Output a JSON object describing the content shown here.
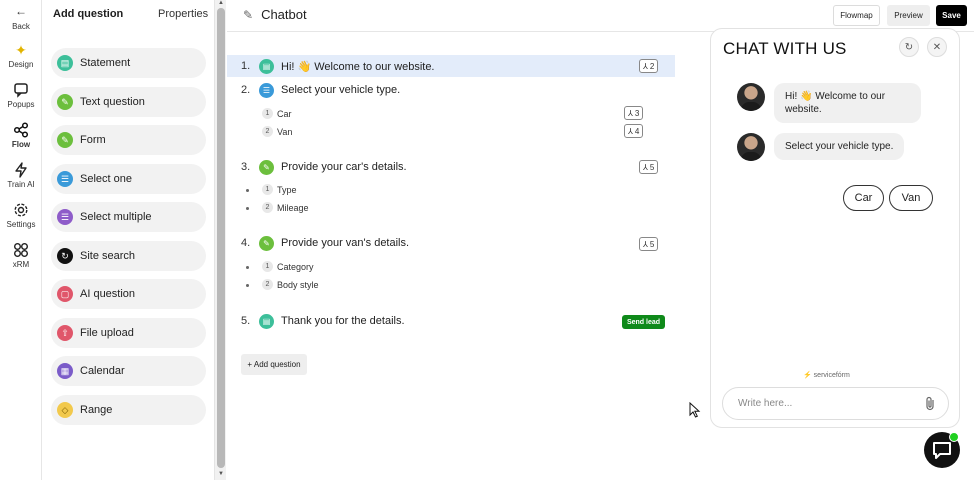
{
  "rail": {
    "back": "Back",
    "items": [
      {
        "label": "Design",
        "icon": "sparkle-icon"
      },
      {
        "label": "Popups",
        "icon": "popup-icon"
      },
      {
        "label": "Flow",
        "icon": "flow-icon"
      },
      {
        "label": "Train AI",
        "icon": "lightning-icon"
      },
      {
        "label": "Settings",
        "icon": "gear-icon"
      },
      {
        "label": "xRM",
        "icon": "grid-icon"
      }
    ]
  },
  "panel": {
    "tab_add": "Add question",
    "tab_properties": "Properties",
    "types": [
      {
        "label": "Statement",
        "color": "#3dbf9a"
      },
      {
        "label": "Text question",
        "color": "#6cbf3d"
      },
      {
        "label": "Form",
        "color": "#6cbf3d"
      },
      {
        "label": "Select one",
        "color": "#3a9ad9"
      },
      {
        "label": "Select multiple",
        "color": "#8e5cc9"
      },
      {
        "label": "Site search",
        "color": "#111111"
      },
      {
        "label": "AI question",
        "color": "#e0566a"
      },
      {
        "label": "File upload",
        "color": "#e0566a"
      },
      {
        "label": "Calendar",
        "color": "#7b5cc9"
      },
      {
        "label": "Range",
        "color": "#f2c94c"
      }
    ]
  },
  "topbar": {
    "title": "Chatbot",
    "flowmap": "Flowmap",
    "preview": "Preview",
    "save": "Save"
  },
  "flow": {
    "questions": [
      {
        "num": "1.",
        "text": "Hi! 👋 Welcome to our website.",
        "jump": "2",
        "color": "#3dbf9a"
      },
      {
        "num": "2.",
        "text": "Select your vehicle type.",
        "color": "#3a9ad9",
        "options": [
          {
            "n": "1",
            "label": "Car",
            "jump": "3"
          },
          {
            "n": "2",
            "label": "Van",
            "jump": "4"
          }
        ]
      },
      {
        "num": "3.",
        "text": "Provide your car's details.",
        "jump": "5",
        "color": "#6cbf3d",
        "options": [
          {
            "n": "1",
            "label": "Type"
          },
          {
            "n": "2",
            "label": "Mileage"
          }
        ]
      },
      {
        "num": "4.",
        "text": "Provide your van's details.",
        "jump": "5",
        "color": "#6cbf3d",
        "options": [
          {
            "n": "1",
            "label": "Category"
          },
          {
            "n": "2",
            "label": "Body style"
          }
        ]
      },
      {
        "num": "5.",
        "text": "Thank you for the details.",
        "badge": "Send lead",
        "color": "#3dbf9a"
      }
    ],
    "add_question": "+ Add question"
  },
  "chat": {
    "title": "CHAT WITH US",
    "messages": [
      "Hi! 👋 Welcome to our website.",
      "Select your vehicle type."
    ],
    "choices": [
      "Car",
      "Van"
    ],
    "powered_by": "servicefórm",
    "input_placeholder": "Write here..."
  }
}
